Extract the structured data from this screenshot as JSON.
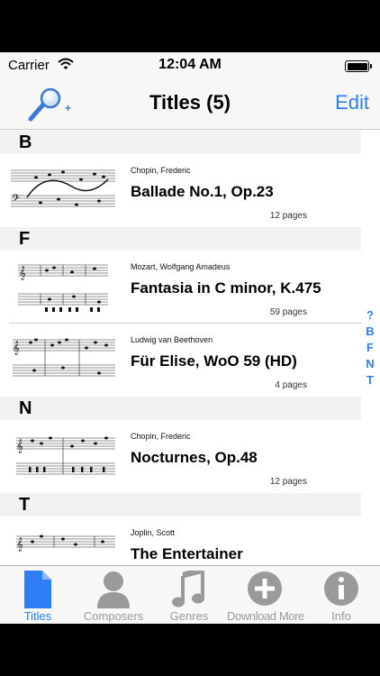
{
  "status_bar": {
    "carrier": "Carrier",
    "time": "12:04 AM"
  },
  "nav": {
    "title": "Titles (5)",
    "edit_label": "Edit",
    "search_icon": "magnifier-plus-icon"
  },
  "sections": [
    {
      "letter": "B",
      "items": [
        {
          "composer": "Chopin, Frederic",
          "title": "Ballade No.1, Op.23",
          "pages": "12 pages"
        }
      ]
    },
    {
      "letter": "F",
      "items": [
        {
          "composer": "Mozart, Wolfgang Amadeus",
          "title": "Fantasia in C minor, K.475",
          "pages": "59 pages"
        },
        {
          "composer": "Ludwig van Beethoven",
          "title": "Für Elise, WoO 59  (HD)",
          "pages": "4 pages"
        }
      ]
    },
    {
      "letter": "N",
      "items": [
        {
          "composer": "Chopin, Frederic",
          "title": "Nocturnes, Op.48",
          "pages": "12 pages"
        }
      ]
    },
    {
      "letter": "T",
      "items": [
        {
          "composer": "Joplin, Scott",
          "title": "The Entertainer",
          "pages": ""
        }
      ]
    }
  ],
  "index": [
    "?",
    "B",
    "F",
    "N",
    "T"
  ],
  "tabs": [
    {
      "label": "Titles",
      "icon": "document-icon",
      "active": true
    },
    {
      "label": "Composers",
      "icon": "person-icon",
      "active": false
    },
    {
      "label": "Genres",
      "icon": "music-note-icon",
      "active": false
    },
    {
      "label": "Download More",
      "icon": "plus-circle-icon",
      "active": false
    },
    {
      "label": "Info",
      "icon": "info-icon",
      "active": false
    }
  ],
  "colors": {
    "accent": "#2f7ef6",
    "tab_inactive": "#9a9a9a",
    "section_bg": "#f2f2f2",
    "bar_bg": "#f7f7f7"
  }
}
